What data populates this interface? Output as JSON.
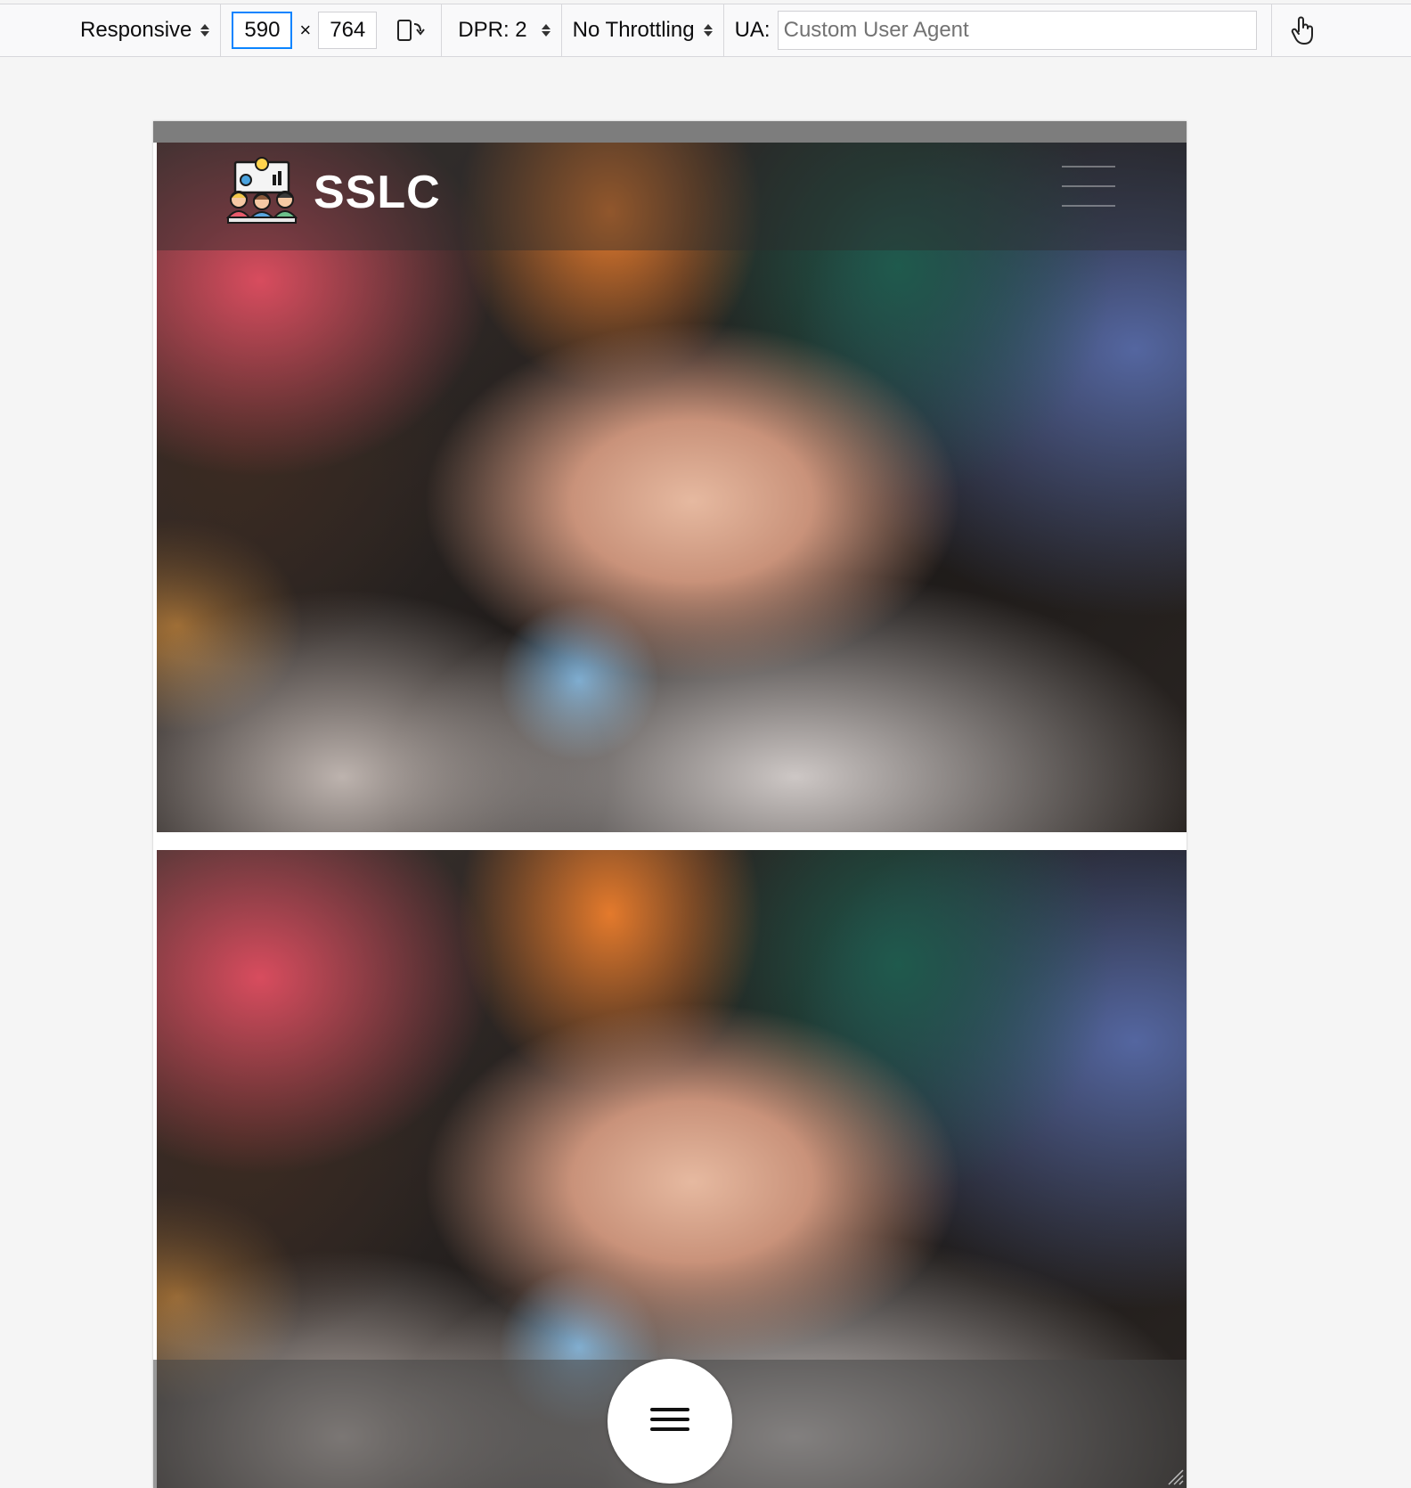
{
  "toolbar": {
    "device_label": "Responsive",
    "width_value": "590",
    "times_symbol": "×",
    "height_value": "764",
    "dpr_label": "DPR: 2",
    "throttling_label": "No Throttling",
    "ua_label": "UA:",
    "ua_placeholder": "Custom User Agent",
    "rotate_icon": "rotate-device-icon",
    "touch_icon": "touch-simulation-icon"
  },
  "site": {
    "title": "SSLC",
    "logo_icon": "community-logo-icon",
    "menu_icon": "hamburger-menu-icon",
    "fab_icon": "hamburger-menu-icon"
  },
  "colors": {
    "focus_border": "#0a84ff",
    "header_overlay": "rgba(45,45,45,0.45)",
    "title_text": "#ffffff"
  }
}
